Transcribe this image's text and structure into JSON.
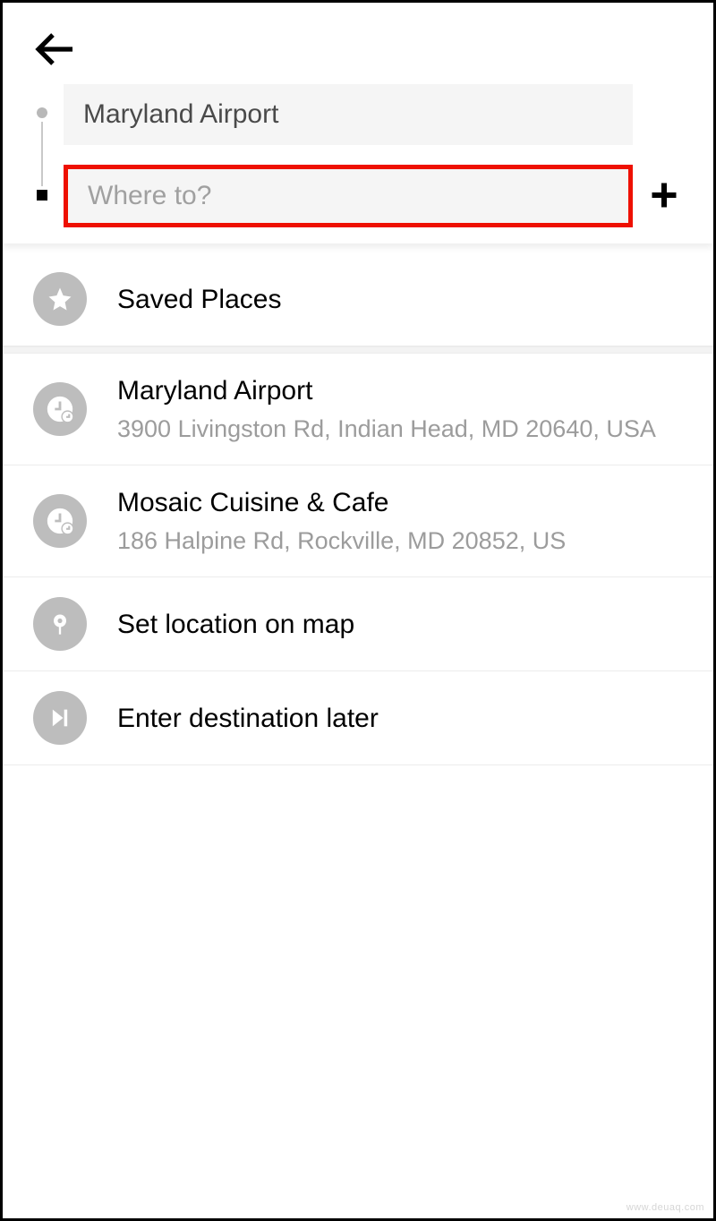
{
  "header": {
    "pickup_value": "Maryland Airport",
    "destination_placeholder": "Where to?"
  },
  "list": {
    "saved_places_label": "Saved Places",
    "recent": [
      {
        "title": "Maryland Airport",
        "subtitle": "3900 Livingston Rd, Indian Head, MD 20640, USA"
      },
      {
        "title": "Mosaic Cuisine & Cafe",
        "subtitle": "186 Halpine Rd, Rockville, MD 20852, US"
      }
    ],
    "set_on_map_label": "Set location on map",
    "enter_later_label": "Enter destination later"
  },
  "watermark": "www.deuaq.com"
}
